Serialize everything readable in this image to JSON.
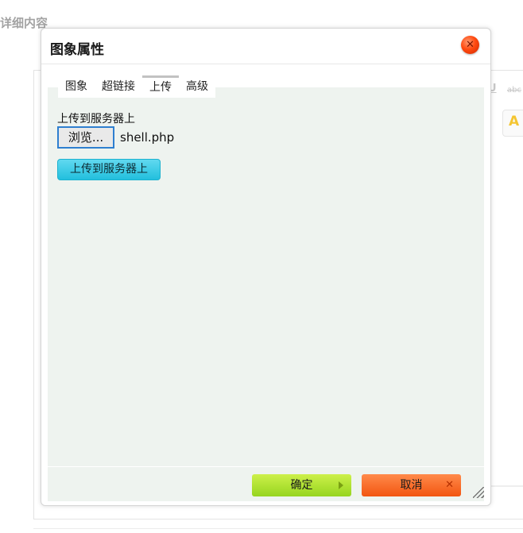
{
  "background": {
    "heading": "详细内容",
    "toolbar_fragment_1": "U",
    "toolbar_fragment_2": "abc",
    "toolbar_glyph": "A"
  },
  "dialog": {
    "title": "图象属性",
    "close_icon": "close-icon"
  },
  "tabs": [
    {
      "label": "图象",
      "active": false
    },
    {
      "label": "超链接",
      "active": false
    },
    {
      "label": "上传",
      "active": true
    },
    {
      "label": "高级",
      "active": false
    }
  ],
  "upload": {
    "label": "上传到服务器上",
    "browse_label": "浏览...",
    "file_name": "shell.php",
    "submit_label": "上传到服务器上"
  },
  "footer": {
    "ok_label": "确定",
    "cancel_label": "取消"
  },
  "colors": {
    "panel_bg": "#eef3ef",
    "ok_button": "#aee02f",
    "cancel_button": "#f86a2c",
    "upload_button": "#3fcde8",
    "close_button": "#ff4a10"
  }
}
